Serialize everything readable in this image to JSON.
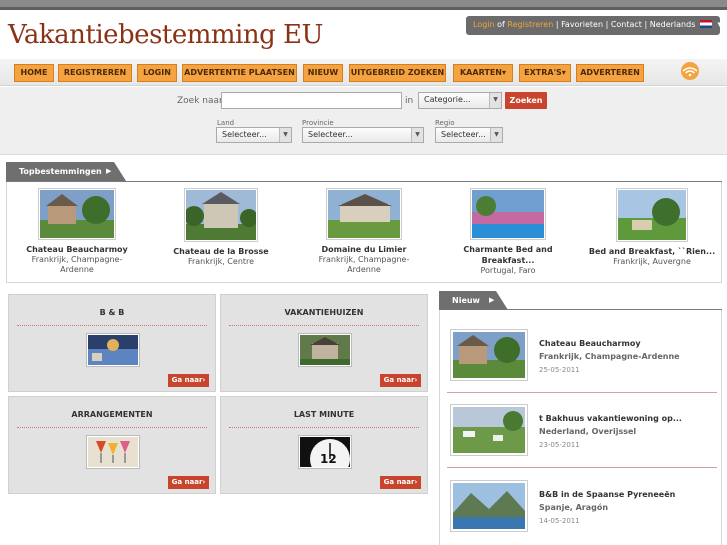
{
  "header": {
    "logo_text": "Vakantiebestemming EU",
    "user": {
      "login": "Login",
      "of": "of",
      "registreren": "Registreren",
      "favorieten": "| Favorieten",
      "contact": "| Contact",
      "language": "| Nederlands"
    }
  },
  "nav": {
    "items": [
      {
        "label": "HOME"
      },
      {
        "label": "REGISTREREN"
      },
      {
        "label": "LOGIN"
      },
      {
        "label": "ADVERTENTIE PLAATSEN"
      },
      {
        "label": "NIEUW"
      },
      {
        "label": "UITGEBREID ZOEKEN"
      },
      {
        "label": "KAARTEN▾"
      },
      {
        "label": "EXTRA'S▾"
      },
      {
        "label": "ADVERTEREN"
      }
    ]
  },
  "search": {
    "label": "Zoek naar:",
    "value": "",
    "in_label": "in",
    "category": "Categorie...",
    "button": "Zoeken",
    "land_label": "Land",
    "land_value": "Selecteer...",
    "provincie_label": "Provincie",
    "provincie_value": "Selecteer...",
    "regio_label": "Regio",
    "regio_value": "Selecteer..."
  },
  "topbestemmingen": {
    "tab": "Topbestemmingen",
    "items": [
      {
        "name": "Chateau Beaucharmoy",
        "loc1": "Frankrijk, Champagne-",
        "loc2": "Ardenne"
      },
      {
        "name": "Chateau de la Brosse",
        "loc1": "Frankrijk, Centre",
        "loc2": ""
      },
      {
        "name": "Domaine du Limier",
        "loc1": "Frankrijk, Champagne-",
        "loc2": "Ardenne"
      },
      {
        "name": "Charmante Bed and",
        "name2": "Breakfast...",
        "loc1": "Portugal, Faro",
        "loc2": ""
      },
      {
        "name": "Bed and Breakfast, ``Rien...",
        "loc1": "Frankrijk, Auvergne",
        "loc2": ""
      }
    ]
  },
  "categories": {
    "items": [
      {
        "title": "B & B",
        "button": "Ga naar›"
      },
      {
        "title": "VAKANTIEHUIZEN",
        "button": "Ga naar›"
      },
      {
        "title": "ARRANGEMENTEN",
        "button": "Ga naar›"
      },
      {
        "title": "LAST MINUTE",
        "button": "Ga naar›"
      }
    ]
  },
  "nieuw": {
    "tab": "Nieuw",
    "items": [
      {
        "title": "Chateau Beaucharmoy",
        "location": "Frankrijk, Champagne-Ardenne",
        "date": "25-05-2011"
      },
      {
        "title": "t Bakhuus vakantiewoning op...",
        "location": "Nederland, Overijssel",
        "date": "23-05-2011"
      },
      {
        "title": "B&B in de Spaanse Pyreneeën",
        "location": "Spanje, Aragón",
        "date": "14-05-2011"
      }
    ]
  },
  "colors": {
    "accent": "#f5a340",
    "button_red": "#c9442c",
    "logo": "#8b3216"
  }
}
